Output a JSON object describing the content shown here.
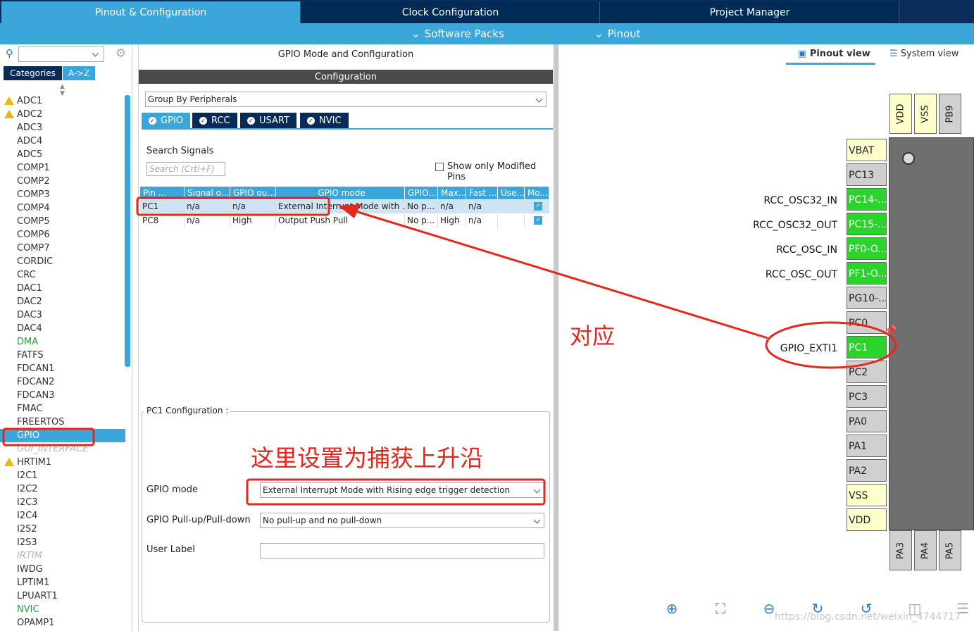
{
  "top_tabs": {
    "pinout": "Pinout & Configuration",
    "clock": "Clock Configuration",
    "project": "Project Manager"
  },
  "sub_menu": {
    "software_packs": "Software Packs",
    "pinout": "Pinout"
  },
  "left": {
    "tab_categories": "Categories",
    "tab_az": "A->Z",
    "items": [
      {
        "label": "ADC1",
        "warn": true
      },
      {
        "label": "ADC2",
        "warn": true
      },
      {
        "label": "ADC3"
      },
      {
        "label": "ADC4"
      },
      {
        "label": "ADC5"
      },
      {
        "label": "COMP1"
      },
      {
        "label": "COMP2"
      },
      {
        "label": "COMP3"
      },
      {
        "label": "COMP4"
      },
      {
        "label": "COMP5"
      },
      {
        "label": "COMP6"
      },
      {
        "label": "COMP7"
      },
      {
        "label": "CORDIC"
      },
      {
        "label": "CRC"
      },
      {
        "label": "DAC1"
      },
      {
        "label": "DAC2"
      },
      {
        "label": "DAC3"
      },
      {
        "label": "DAC4"
      },
      {
        "label": "DMA",
        "style": "green"
      },
      {
        "label": "FATFS"
      },
      {
        "label": "FDCAN1"
      },
      {
        "label": "FDCAN2"
      },
      {
        "label": "FDCAN3"
      },
      {
        "label": "FMAC"
      },
      {
        "label": "FREERTOS"
      },
      {
        "label": "GPIO",
        "style": "sel"
      },
      {
        "label": "GUI_INTERFACE",
        "style": "gray"
      },
      {
        "label": "HRTIM1",
        "warn": true
      },
      {
        "label": "I2C1"
      },
      {
        "label": "I2C2"
      },
      {
        "label": "I2C3"
      },
      {
        "label": "I2C4"
      },
      {
        "label": "I2S2"
      },
      {
        "label": "I2S3"
      },
      {
        "label": "IRTIM",
        "style": "gray"
      },
      {
        "label": "IWDG"
      },
      {
        "label": "LPTIM1"
      },
      {
        "label": "LPUART1"
      },
      {
        "label": "NVIC",
        "style": "green"
      },
      {
        "label": "OPAMP1"
      }
    ]
  },
  "middle": {
    "title": "GPIO Mode and Configuration",
    "config_header": "Configuration",
    "group_by": "Group By Peripherals",
    "chips": [
      "GPIO",
      "RCC",
      "USART",
      "NVIC"
    ],
    "search_label": "Search Signals",
    "search_placeholder": "Search (Crtl+F)",
    "show_modified": "Show only Modified Pins",
    "columns": [
      "Pin ...",
      "Signal o...",
      "GPIO ou...",
      "GPIO mode",
      "GPIO...",
      "Max...",
      "Fast ...",
      "Use...",
      "Mo..."
    ],
    "rows": [
      [
        "PC1",
        "n/a",
        "n/a",
        "External Interrupt Mode with ...",
        "No p...",
        "n/a",
        "n/a",
        ""
      ],
      [
        "PC8",
        "n/a",
        "High",
        "Output Push Pull",
        "No p...",
        "High",
        "n/a",
        ""
      ]
    ],
    "pc1_config": "PC1 Configuration :",
    "gpio_mode_label": "GPIO mode",
    "gpio_mode_value": "External Interrupt Mode with Rising edge trigger detection",
    "pull_label": "GPIO Pull-up/Pull-down",
    "pull_value": "No pull-up and no pull-down",
    "user_label": "User Label"
  },
  "right": {
    "pinout_view": "Pinout view",
    "system_view": "System view",
    "top_pins": [
      {
        "label": "VDD",
        "style": "yellow"
      },
      {
        "label": "VSS",
        "style": "yellow"
      },
      {
        "label": "PB9"
      }
    ],
    "left_pins": [
      {
        "label": "VBAT",
        "style": "yellow"
      },
      {
        "label": "PC13"
      },
      {
        "label": "PC14-...",
        "style": "green"
      },
      {
        "label": "PC15-...",
        "style": "green"
      },
      {
        "label": "PF0-O...",
        "style": "green"
      },
      {
        "label": "PF1-O...",
        "style": "green"
      },
      {
        "label": "PG10-..."
      },
      {
        "label": "PC0"
      },
      {
        "label": "PC1",
        "style": "green"
      },
      {
        "label": "PC2"
      },
      {
        "label": "PC3"
      },
      {
        "label": "PA0"
      },
      {
        "label": "PA1"
      },
      {
        "label": "PA2"
      },
      {
        "label": "VSS",
        "style": "yellow"
      },
      {
        "label": "VDD",
        "style": "yellow"
      }
    ],
    "bottom_pins": [
      "PA3",
      "PA4",
      "PA5"
    ],
    "signals": {
      "osc32_in": "RCC_OSC32_IN",
      "osc32_out": "RCC_OSC32_OUT",
      "osc_in": "RCC_OSC_IN",
      "osc_out": "RCC_OSC_OUT",
      "exti1": "GPIO_EXTI1"
    }
  },
  "annotations": {
    "correspond": "对应",
    "set_rising": "这里设置为捕获上升沿",
    "color": "#e8261c"
  },
  "watermark": "https://blog.csdn.net/weixin_4744717"
}
